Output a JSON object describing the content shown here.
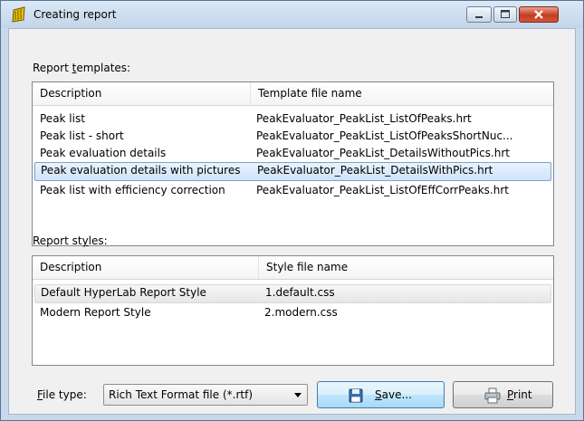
{
  "window": {
    "title": "Creating report",
    "app_icon": "report-folder-icon",
    "controls": {
      "minimize": "minimize-icon",
      "maximize": "maximize-icon",
      "close": "close-icon"
    }
  },
  "templates": {
    "label_pre": "Report ",
    "label_access": "t",
    "label_post": "emplates:",
    "columns": [
      "Description",
      "Template file name"
    ],
    "rows": [
      {
        "description": "Peak list",
        "file": "PeakEvaluator_PeakList_ListOfPeaks.hrt"
      },
      {
        "description": "Peak list - short",
        "file": "PeakEvaluator_PeakList_ListOfPeaksShortNuc..."
      },
      {
        "description": "Peak evaluation details",
        "file": "PeakEvaluator_PeakList_DetailsWithoutPics.hrt"
      },
      {
        "description": "Peak evaluation details with pictures",
        "file": "PeakEvaluator_PeakList_DetailsWithPics.hrt"
      },
      {
        "description": "Peak list with efficiency correction",
        "file": "PeakEvaluator_PeakList_ListOfEffCorrPeaks.hrt"
      }
    ],
    "selected_index": 3
  },
  "styles": {
    "label_pre": "Report st",
    "label_access": "y",
    "label_post": "les:",
    "columns": [
      "Description",
      "Style file name"
    ],
    "rows": [
      {
        "description": "Default HyperLab Report Style",
        "file": "1.default.css"
      },
      {
        "description": "Modern Report Style",
        "file": "2.modern.css"
      }
    ],
    "selected_index": 0
  },
  "footer": {
    "filetype_label_access": "F",
    "filetype_label_post": "ile type:",
    "filetype_value": "Rich Text Format file (*.rtf)",
    "save_access": "S",
    "save_post": "ave...",
    "save_icon": "floppy-disk-icon",
    "print_access": "P",
    "print_post": "rint",
    "print_icon": "printer-icon"
  },
  "colors": {
    "selection_border": "#7da2ce",
    "selection_fill": "#cfe3fa",
    "titlebar": "#c3d5ea",
    "close_button": "#c43c21"
  }
}
